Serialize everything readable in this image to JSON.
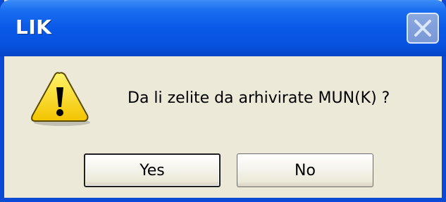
{
  "window": {
    "title": "LIK",
    "close_icon": "close-x-icon"
  },
  "dialog": {
    "icon": "warning-icon",
    "message": "Da li zelite da arhivirate MUN(K) ?"
  },
  "buttons": {
    "yes_label": "Yes",
    "no_label": "No"
  },
  "colors": {
    "titlebar": "#0a59e8",
    "body": "#ece9d8",
    "warning_fill": "#ffe600"
  }
}
